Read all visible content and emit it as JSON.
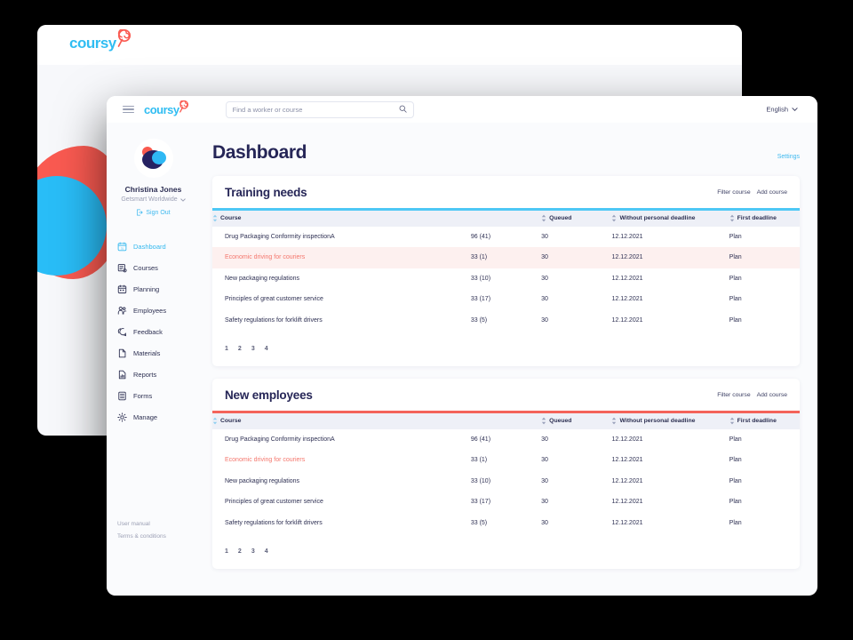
{
  "brand": {
    "logo_text": "coursy",
    "accent_cyan": "#30bdf2",
    "accent_coral": "#fa5a51",
    "navy": "#262657"
  },
  "back_window": {
    "logo_text": "coursy"
  },
  "topbar": {
    "logo_text": "coursy",
    "menu_icon": "hamburger-icon",
    "search": {
      "placeholder": "Find a worker or course",
      "value": "",
      "icon": "search-icon"
    },
    "language": {
      "label": "English",
      "chevron": "⌄"
    }
  },
  "sidebar": {
    "avatar": "user-avatar",
    "user_name": "Christina Jones",
    "organization": "Getsmart Worldwide",
    "organization_chevron": "⌄",
    "sign_out": "Sign Out",
    "items": [
      {
        "label": "Dashboard",
        "icon": "calendar-dashboard-icon",
        "active": true
      },
      {
        "label": "Courses",
        "icon": "course-book-icon",
        "active": false
      },
      {
        "label": "Planning",
        "icon": "calendar-icon",
        "active": false
      },
      {
        "label": "Employees",
        "icon": "people-icon",
        "active": false
      },
      {
        "label": "Feedback",
        "icon": "chat-feedback-icon",
        "active": false
      },
      {
        "label": "Materials",
        "icon": "document-icon",
        "active": false
      },
      {
        "label": "Reports",
        "icon": "bar-chart-icon",
        "active": false
      },
      {
        "label": "Forms",
        "icon": "form-list-icon",
        "active": false
      },
      {
        "label": "Manage",
        "icon": "gear-icon",
        "active": false
      }
    ],
    "footer_links": [
      "User manual",
      "Terms & conditions"
    ]
  },
  "main": {
    "page_title": "Dashboard",
    "settings_link": "Settings",
    "cards": [
      {
        "title": "Training needs",
        "accent_color": "#4ec8f5",
        "actions": [
          "Filter course",
          "Add course"
        ],
        "columns": [
          "Course",
          "Queued",
          "Without personal deadline",
          "First deadline"
        ],
        "rows": [
          {
            "course": "Drug Packaging Conformity inspectionA",
            "progress": "96  (41)",
            "queued": "30",
            "without_personal_deadline": "12.12.2021",
            "first_deadline": "Plan",
            "alert": false,
            "highlight": false
          },
          {
            "course": "Economic driving for couriers",
            "progress": "33  (1)",
            "queued": "30",
            "without_personal_deadline": "12.12.2021",
            "first_deadline": "Plan",
            "alert": true,
            "highlight": true
          },
          {
            "course": "New packaging regulations",
            "progress": "33  (10)",
            "queued": "30",
            "without_personal_deadline": "12.12.2021",
            "first_deadline": "Plan",
            "alert": false,
            "highlight": false
          },
          {
            "course": "Principles of great customer service",
            "progress": "33  (17)",
            "queued": "30",
            "without_personal_deadline": "12.12.2021",
            "first_deadline": "Plan",
            "alert": false,
            "highlight": false
          },
          {
            "course": "Safety regulations for forklift drivers",
            "progress": "33  (5)",
            "queued": "30",
            "without_personal_deadline": "12.12.2021",
            "first_deadline": "Plan",
            "alert": false,
            "highlight": false
          }
        ],
        "pagination": [
          "1",
          "2",
          "3",
          "4"
        ]
      },
      {
        "title": "New employees",
        "accent_color": "#f4635a",
        "actions": [
          "Filter course",
          "Add course"
        ],
        "columns": [
          "Course",
          "Queued",
          "Without personal deadline",
          "First deadline"
        ],
        "rows": [
          {
            "course": "Drug Packaging Conformity inspectionA",
            "progress": "96 (41)",
            "queued": "30",
            "without_personal_deadline": "12.12.2021",
            "first_deadline": "Plan",
            "alert": false,
            "highlight": false
          },
          {
            "course": "Economic driving for couriers",
            "progress": "33 (1)",
            "queued": "30",
            "without_personal_deadline": "12.12.2021",
            "first_deadline": "Plan",
            "alert": true,
            "highlight": false
          },
          {
            "course": "New packaging regulations",
            "progress": "33 (10)",
            "queued": "30",
            "without_personal_deadline": "12.12.2021",
            "first_deadline": "Plan",
            "alert": false,
            "highlight": false
          },
          {
            "course": "Principles of great customer service",
            "progress": "33 (17)",
            "queued": "30",
            "without_personal_deadline": "12.12.2021",
            "first_deadline": "Plan",
            "alert": false,
            "highlight": false
          },
          {
            "course": "Safety regulations for forklift drivers",
            "progress": "33 (5)",
            "queued": "30",
            "without_personal_deadline": "12.12.2021",
            "first_deadline": "Plan",
            "alert": false,
            "highlight": false
          }
        ],
        "pagination": [
          "1",
          "2",
          "3",
          "4"
        ]
      }
    ]
  }
}
